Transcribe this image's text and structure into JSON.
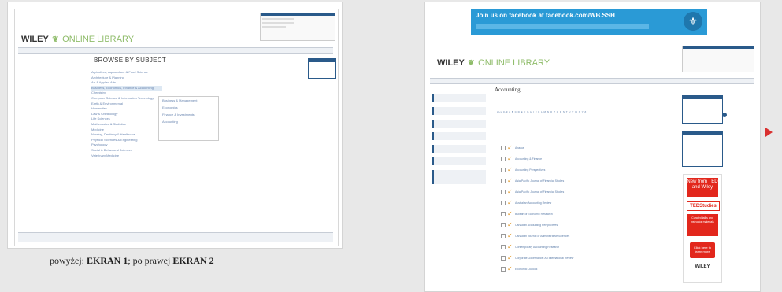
{
  "caption": {
    "prefix": "powyżej: ",
    "screen1": "EKRAN 1",
    "sep": ";  po prawej ",
    "screen2": "EKRAN 2"
  },
  "screen1": {
    "logo_brand": "WILEY",
    "logo_rest": "ONLINE LIBRARY",
    "browse_title": "BROWSE BY SUBJECT",
    "subjects": [
      "Agriculture, Aquaculture & Food Science",
      "Architecture & Planning",
      "Art & Applied Arts",
      "Business, Economics, Finance & Accounting",
      "Chemistry",
      "Computer Science & Information Technology",
      "Earth & Environmental",
      "Humanities",
      "Law & Criminology",
      "Life Sciences",
      "Mathematics & Statistics",
      "Medicine",
      "Nursing, Dentistry & Healthcare",
      "Physical Sciences & Engineering",
      "Psychology",
      "Social & Behavioral Sciences",
      "Veterinary Medicine"
    ],
    "popout": [
      "Business & Management",
      "Economics",
      "Finance & Investments",
      "Accounting"
    ]
  },
  "screen2": {
    "banner_text": "Join us on facebook at facebook.com/WB.SSH",
    "logo_brand": "WILEY",
    "logo_rest": "ONLINE LIBRARY",
    "page_title": "Accounting",
    "alphabet": "ALL 0-9 A B C D E F G H I J K L M N O P Q R S T U V W X Y Z",
    "rows": [
      "Abacus",
      "Accounting & Finance",
      "Accounting Perspectives",
      "Asia-Pacific Journal of Financial Studies",
      "Asia-Pacific Journal of Financial Studies",
      "Australian Accounting Review",
      "Bulletin of Economic Research",
      "Canadian Accounting Perspectives",
      "Canadian Journal of Administrative Sciences",
      "Contemporary Accounting Research",
      "Corporate Governance: An International Review",
      "Economic Outlook"
    ],
    "ted": {
      "new_from": "New from TED and Wiley",
      "ted_studies": "TEDStudies",
      "curated": "Curated talks and instructor materials",
      "click": "Click here to learn more",
      "wiley": "WILEY"
    }
  }
}
